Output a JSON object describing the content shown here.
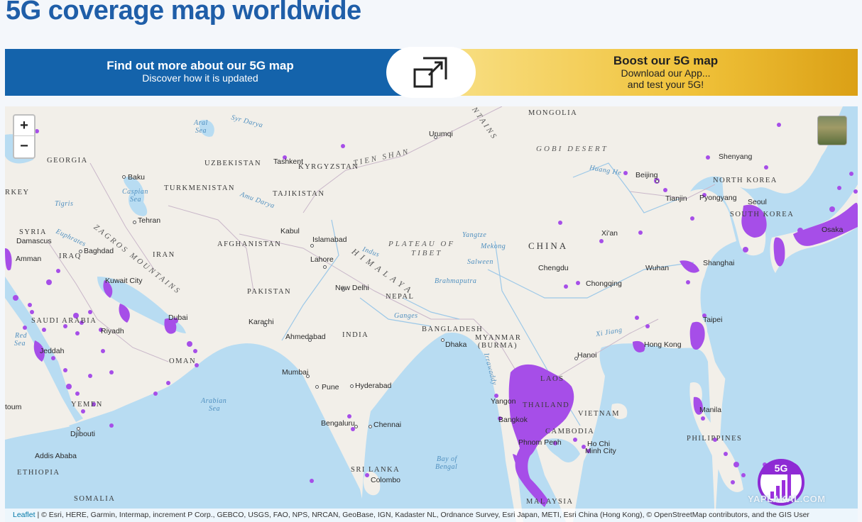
{
  "page": {
    "title": "5G coverage map worldwide"
  },
  "banner": {
    "left_title": "Find out more about our 5G map",
    "left_subtitle": "Discover how it is updated",
    "right_title": "Boost our 5G map",
    "right_line1": "Download our App...",
    "right_line2": "and test your 5G!",
    "icon": "expand-icon"
  },
  "map": {
    "zoom_in": "+",
    "zoom_out": "−",
    "layer_icon": "satellite-layer-icon",
    "coverage_color": "#a64ee8",
    "water_color": "#b8dcf2",
    "land_color": "#f2efe9",
    "countries": {
      "georgia": "GEORGIA",
      "uzbekistan": "UZBEKISTAN",
      "kyrgyzstan": "KYRGYZSTAN",
      "mongolia": "MONGOLIA",
      "turkey": "RKEY",
      "turkmenistan": "TURKMENISTAN",
      "tajikistan": "TAJIKISTAN",
      "north_korea": "NORTH KOREA",
      "south_korea": "SOUTH KOREA",
      "syria": "SYRIA",
      "afghanistan": "AFGHANISTAN",
      "iraq": "IRAQ",
      "iran": "IRAN",
      "china": "CHINA",
      "pakistan": "PAKISTAN",
      "nepal": "NEPAL",
      "saudi_arabia": "SAUDI ARABIA",
      "india": "INDIA",
      "bangladesh": "BANGLADESH",
      "myanmar": "MYANMAR",
      "burma": "(BURMA)",
      "oman": "OMAN",
      "laos": "LAOS",
      "thailand": "THAILAND",
      "vietnam": "VIETNAM",
      "yemen": "YEMEN",
      "cambodia": "CAMBODIA",
      "philippines": "PHILIPPINES",
      "ethiopia": "ETHIOPIA",
      "sri_lanka": "SRI LANKA",
      "somalia": "SOMALIA",
      "malaysia": "MALAYSIA"
    },
    "cities": {
      "urumqi": "Urumqi",
      "baku": "Baku",
      "tashkent": "Tashkent",
      "shenyang": "Shenyang",
      "beijing": "Beijing",
      "tianjin": "Tianjin",
      "pyongyang": "Pyongyang",
      "seoul": "Seoul",
      "tehran": "Tehran",
      "kabul": "Kabul",
      "islamabad": "Islamabad",
      "xian": "Xi'an",
      "osaka": "Osaka",
      "damascus": "Damascus",
      "baghdad": "Baghdad",
      "amman": "Amman",
      "lahore": "Lahore",
      "chengdu": "Chengdu",
      "wuhan": "Wuhan",
      "shanghai": "Shanghai",
      "kuwait_city": "Kuwait City",
      "new_delhi": "New Delhi",
      "chongqing": "Chongqing",
      "dubai": "Dubai",
      "karachi": "Karachi",
      "riyadh": "Riyadh",
      "taipei": "Taipei",
      "jeddah": "Jeddah",
      "ahmedabad": "Ahmedabad",
      "dhaka": "Dhaka",
      "hong_kong": "Hong Kong",
      "hanoi": "Hanoi",
      "mumbai": "Mumbai",
      "pune": "Pune",
      "hyderabad": "Hyderabad",
      "yangon": "Yangon",
      "khartoum": "toum",
      "manila": "Manila",
      "bangkok": "Bangkok",
      "bengaluru": "Bengaluru",
      "chennai": "Chennai",
      "djibouti": "Djibouti",
      "phnom_penh": "Phnom Penh",
      "ho_chi_minh_1": "Ho Chi",
      "ho_chi_minh_2": "Minh City",
      "addis_ababa": "Addis Ababa",
      "colombo": "Colombo"
    },
    "water": {
      "aral_1": "Aral",
      "aral_2": "Sea",
      "syr_darya": "Syr Darya",
      "caspian_1": "Caspian",
      "caspian_2": "Sea",
      "amu_darya": "Amu Darya",
      "tigris": "Tigris",
      "euphrates": "Euphrates",
      "indus": "Indus",
      "huang_he": "Huang He",
      "yangtze": "Yangtze",
      "mekong": "Mekong",
      "salween": "Salween",
      "brahmaputra": "Brahmaputra",
      "ganges": "Ganges",
      "xi_jiang": "Xi Jiang",
      "irrawaddy": "Irrawaddy",
      "red_sea_1": "Red",
      "red_sea_2": "Sea",
      "arabian_sea_1": "Arabian",
      "arabian_sea_2": "Sea",
      "bay_bengal_1": "Bay of",
      "bay_bengal_2": "Bengal"
    },
    "regions": {
      "tien_shan": "TIEN SHAN",
      "mountains": "UNTAINS",
      "gobi": "GOBI DESERT",
      "zagros": "ZAGROS MOUNTAINS",
      "plateau": "PLATEAU OF",
      "tibet": "TIBET",
      "himalaya": "HIMALAYA"
    },
    "logo_text": "5G",
    "watermark": "YAPLAKAL.COM",
    "attribution_link": "Leaflet",
    "attribution_text": " | © Esri, HERE, Garmin, Intermap, increment P Corp., GEBCO, USGS, FAO, NPS, NRCAN, GeoBase, IGN, Kadaster NL, Ordnance Survey, Esri Japan, METI, Esri China (Hong Kong), © OpenStreetMap contributors, and the GIS User"
  }
}
